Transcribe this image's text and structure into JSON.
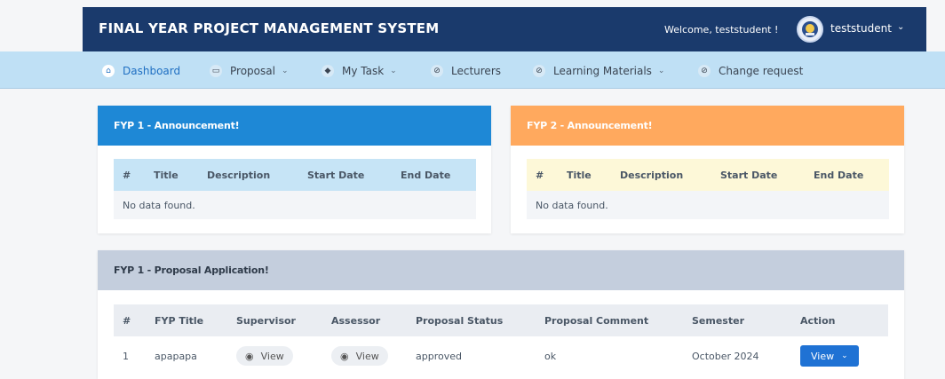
{
  "header": {
    "brand": "FINAL YEAR PROJECT MANAGEMENT SYSTEM",
    "welcome": "Welcome, teststudent !",
    "user": "teststudent",
    "user_caret": "⌄"
  },
  "nav": {
    "items": [
      {
        "label": "Dashboard",
        "icon": "home-icon",
        "glyph": "⌂",
        "caret": ""
      },
      {
        "label": "Proposal",
        "icon": "document-icon",
        "glyph": "▭",
        "caret": "⌄"
      },
      {
        "label": "My Task",
        "icon": "diamond-icon",
        "glyph": "◆",
        "caret": "⌄"
      },
      {
        "label": "Lecturers",
        "icon": "compass-icon",
        "glyph": "⊘",
        "caret": ""
      },
      {
        "label": "Learning Materials",
        "icon": "compass-icon",
        "glyph": "⊘",
        "caret": "⌄"
      },
      {
        "label": "Change request",
        "icon": "compass-icon",
        "glyph": "⊘",
        "caret": ""
      }
    ]
  },
  "fyp1_announcement": {
    "title": "FYP 1 - Announcement!",
    "color": "#1e88d6",
    "columns": [
      "#",
      "Title",
      "Description",
      "Start Date",
      "End Date"
    ],
    "empty": "No data found."
  },
  "fyp2_announcement": {
    "title": "FYP 2 - Announcement!",
    "color": "#ffa95e",
    "columns": [
      "#",
      "Title",
      "Description",
      "Start Date",
      "End Date"
    ],
    "empty": "No data found."
  },
  "proposal": {
    "title": "FYP 1 - Proposal Application!",
    "color": "#c4cedd",
    "columns": [
      "#",
      "FYP Title",
      "Supervisor",
      "Assessor",
      "Proposal Status",
      "Proposal Comment",
      "Semester",
      "Action"
    ],
    "rows": [
      {
        "num": "1",
        "fyp_title": "apapapa",
        "supervisor": "View",
        "assessor": "View",
        "status": "approved",
        "comment": "ok",
        "semester": "October 2024",
        "action": "View"
      }
    ]
  }
}
